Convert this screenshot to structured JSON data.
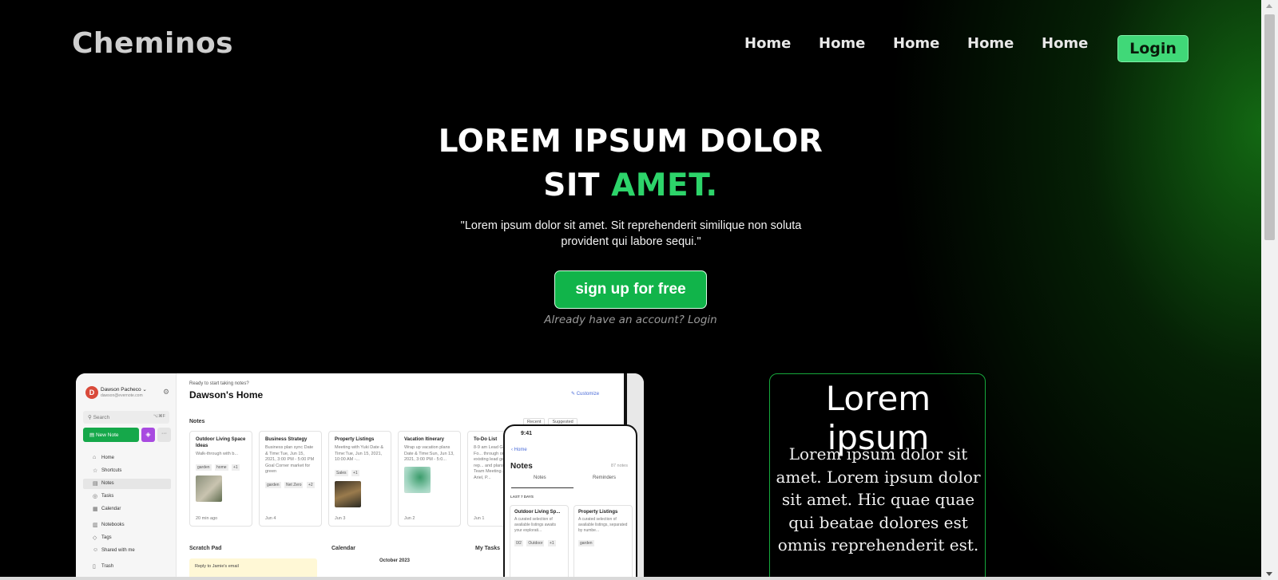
{
  "brand": {
    "logo": "Cheminos"
  },
  "nav": {
    "items": [
      {
        "label": "Home"
      },
      {
        "label": "Home"
      },
      {
        "label": "Home"
      },
      {
        "label": "Home"
      },
      {
        "label": "Home"
      }
    ],
    "login_label": "Login"
  },
  "hero": {
    "title_line1": "LOREM IPSUM DOLOR",
    "title_line2_prefix": "SIT",
    "title_line2_accent": "AMET.",
    "subtitle": "\"Lorem ipsum dolor sit amet. Sit reprehenderit similique non soluta provident qui labore sequi.\"",
    "cta_label": "sign up for free",
    "already_text": "Already have an account? Login"
  },
  "info_card": {
    "title": "Lorem ipsum",
    "text": "Lorem ipsum dolor sit amet. Lorem ipsum dolor sit amet. Hic quae quae qui beatae dolores est omnis reprehenderit est."
  },
  "app_preview": {
    "user_name": "Dawson Pacheco ⌄",
    "user_email": "dawson@evernote.com",
    "search_placeholder": "Search",
    "search_shortcut": "⌥⌘F",
    "new_note_label": "New Note",
    "sidebar_items": [
      {
        "label": "Home",
        "icon": "home-icon"
      },
      {
        "label": "Shortcuts",
        "icon": "star-icon"
      },
      {
        "label": "Notes",
        "icon": "note-icon"
      },
      {
        "label": "Tasks",
        "icon": "check-icon"
      },
      {
        "label": "Calendar",
        "icon": "calendar-icon"
      },
      {
        "label": "Notebooks",
        "icon": "book-icon"
      },
      {
        "label": "Tags",
        "icon": "tag-icon"
      },
      {
        "label": "Shared with me",
        "icon": "users-icon"
      },
      {
        "label": "Trash",
        "icon": "trash-icon"
      }
    ],
    "header_sub": "Ready to start taking notes?",
    "header_title": "Dawson's Home",
    "customize_label": "Customize",
    "notes_label": "Notes",
    "notes_tabs": [
      "Recent",
      "Suggested"
    ],
    "notes": [
      {
        "title": "Outdoor Living Space Ideas",
        "body": "Walk-through with b...",
        "tags": [
          "garden",
          "home",
          "+1"
        ],
        "date": "20 min ago"
      },
      {
        "title": "Business Strategy",
        "body": "Business plan sync Date & Time:Tue, Jun 15, 2021, 3:00 PM - 5:00 PM Goal Corner market for green",
        "tags": [
          "garden",
          "Net Zero",
          "+2"
        ],
        "date": "Jun 4"
      },
      {
        "title": "Property Listings",
        "body": "Meeting with Yuki Date & Time:Tue, Jun 15, 2021, 10:00 AM -...",
        "tags": [
          "Sales",
          "+1"
        ],
        "date": "Jun 3"
      },
      {
        "title": "Vacation Itinerary",
        "body": "Wrap up vacation plans Date & Time:Sun, Jun 13, 2021, 3:00 PM - 5:0...",
        "tags": [],
        "date": "Jun 2"
      },
      {
        "title": "To-Do List",
        "body": "8-9 am Lead Generation Fo... through on yes existing lead generation rep... and plans. 9-... Team Meeting... in with Ariel, P...",
        "tags": [],
        "date": "Jun 1"
      }
    ],
    "scratch_label": "Scratch Pad",
    "scratch_text": "Reply to Jamie's email",
    "calendar_label": "Calendar",
    "calendar_month": "October 2023",
    "tasks_label": "My Tasks",
    "phone": {
      "time": "9:41",
      "back_label": "Home",
      "title": "Notes",
      "count": "87 notes",
      "tabs": [
        "Notes",
        "Reminders"
      ],
      "section": "LAST 7 DAYS",
      "notes": [
        {
          "title": "Outdoor Living Sp...",
          "body": "A curated selection of available listings awaits your explorati...",
          "tags": [
            "0/2",
            "Outdoor",
            "+1"
          ]
        },
        {
          "title": "Property Listings",
          "body": "A curated selection of available listings, separated by numbe...",
          "tags": [
            "garden"
          ]
        }
      ]
    }
  },
  "colors": {
    "accent_green": "#2dd46a",
    "cta_green": "#11b44a",
    "login_green": "#40d878",
    "card_border": "#16a83c"
  }
}
